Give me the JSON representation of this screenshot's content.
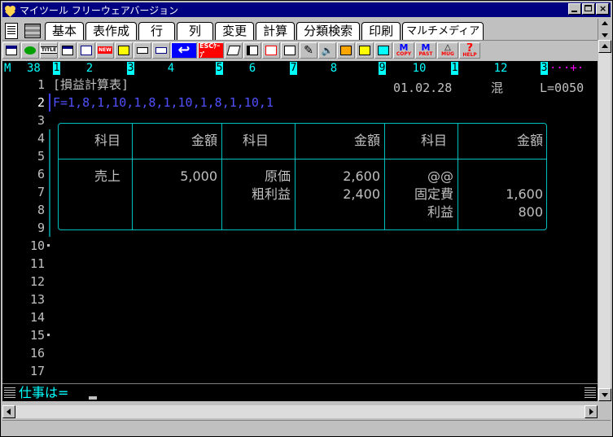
{
  "window": {
    "title": "マイツール フリーウェアバージョン",
    "buttons": {
      "minimize": "_",
      "maximize": "□",
      "close": "×"
    }
  },
  "menu": {
    "tabs": [
      "基本",
      "表作成",
      "行",
      "列",
      "変更",
      "計算",
      "分類検索",
      "印刷",
      "マルチメディア"
    ]
  },
  "toolbar": {
    "icons": [
      "window-icon",
      "chart-icon",
      "title-icon",
      "new-table-icon",
      "copy-window-icon",
      "new-icon",
      "file-icon",
      "print-icon",
      "print-preview-icon",
      "enter-icon",
      "escape-icon",
      "book-icon",
      "layout-icon",
      "insert-icon",
      "paste-icon",
      "pen-icon",
      "speaker-icon",
      "book-open-icon",
      "notepad-icon",
      "transfer-icon",
      "memory-copy-icon",
      "memory-paste-icon",
      "mug-icon",
      "help-icon"
    ],
    "labels": {
      "title": "TITLE",
      "new": "NEW",
      "escape": "ESCｹｰﾌﾟ",
      "m": "M",
      "copy": "COPY",
      "paste": "PAST",
      "mug": "MUG",
      "help": "HELP",
      "q": "?"
    }
  },
  "ruler": {
    "mode": "M",
    "column": "38",
    "markers": [
      "1",
      "2",
      "3",
      "4",
      "5",
      "6",
      "7",
      "8",
      "9",
      "10",
      "1",
      "12",
      "3"
    ],
    "tail": "···+·"
  },
  "editor": {
    "line_numbers": [
      "1",
      "2",
      "3",
      "4",
      "5",
      "6",
      "7",
      "8",
      "9",
      "10",
      "11",
      "12",
      "13",
      "14",
      "15",
      "16",
      "17"
    ],
    "line1": "[損益計算表]",
    "date": "01.02.28",
    "mode": "混",
    "length": "L=0050",
    "line2": "F=1,8,1,10,1,8,1,10,1,8,1,10,1"
  },
  "table": {
    "headers": [
      "科目",
      "金額",
      "科目",
      "金額",
      "科目",
      "金額"
    ],
    "col1": [
      "売上"
    ],
    "col2": [
      "5,000"
    ],
    "col3": [
      "原価",
      "粗利益"
    ],
    "col4": [
      "2,600",
      "2,400"
    ],
    "col5": [
      "@@",
      "固定費",
      "利益"
    ],
    "col6": [
      "",
      "1,600",
      "800"
    ]
  },
  "command": {
    "prompt": "仕事は="
  }
}
